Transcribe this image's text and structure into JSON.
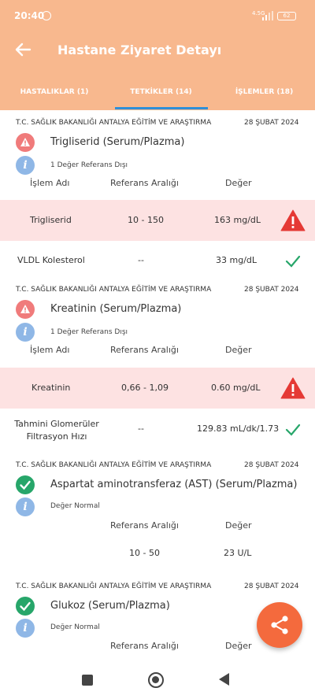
{
  "status_bar": {
    "time": "20:40",
    "network": "4.5G",
    "battery": "62"
  },
  "app_bar": {
    "title": "Hastane Ziyaret Detayı"
  },
  "tabs": [
    {
      "label": "HASTALIKLAR (1)",
      "selected": false
    },
    {
      "label": "TETKİKLER (14)",
      "selected": true
    },
    {
      "label": "İŞLEMLER (18)",
      "selected": false
    }
  ],
  "column_headers": {
    "name": "İşlem Adı",
    "range": "Referans Aralığı",
    "value": "Değer"
  },
  "cards": [
    {
      "hospital": "T.C. SAĞLIK BAKANLIĞI ANTALYA EĞİTİM VE ARAŞTIRMA",
      "date": "28 ŞUBAT 2024",
      "status": "warn",
      "test_name": "Trigliserid (Serum/Plazma)",
      "info": "1 Değer Referans Dışı",
      "rows": [
        {
          "name": "Trigliserid",
          "range": "10 - 150",
          "value": "163 mg/dL",
          "abnormal": true
        },
        {
          "name": "VLDL Kolesterol",
          "range": "--",
          "value": "33 mg/dL",
          "abnormal": false
        }
      ]
    },
    {
      "hospital": "T.C. SAĞLIK BAKANLIĞI ANTALYA EĞİTİM VE ARAŞTIRMA",
      "date": "28 ŞUBAT 2024",
      "status": "warn",
      "test_name": "Kreatinin (Serum/Plazma)",
      "info": "1 Değer Referans Dışı",
      "rows": [
        {
          "name": "Kreatinin",
          "range": "0,66 - 1,09",
          "value": "0.60 mg/dL",
          "abnormal": true
        },
        {
          "name": "Tahmini Glomerüler Filtrasyon Hızı",
          "range": "--",
          "value": "129.83 mL/dk/1.73",
          "abnormal": false
        }
      ]
    },
    {
      "hospital": "T.C. SAĞLIK BAKANLIĞI ANTALYA EĞİTİM VE ARAŞTIRMA",
      "date": "28 ŞUBAT 2024",
      "status": "ok",
      "test_name": "Aspartat aminotransferaz (AST) (Serum/Plazma)",
      "info": "Değer Normal",
      "rows": [
        {
          "name": "",
          "range": "10 - 50",
          "value": "23 U/L",
          "abnormal": false
        }
      ]
    },
    {
      "hospital": "T.C. SAĞLIK BAKANLIĞI ANTALYA EĞİTİM VE ARAŞTIRMA",
      "date": "28 ŞUBAT 2024",
      "status": "ok",
      "test_name": "Glukoz (Serum/Plazma)",
      "info": "Değer Normal"
    }
  ],
  "colors": {
    "header": "#f8b88e",
    "accent": "#2f8fd8",
    "warning": "#e53935",
    "ok": "#27a66a",
    "fab": "#f46a3d"
  }
}
